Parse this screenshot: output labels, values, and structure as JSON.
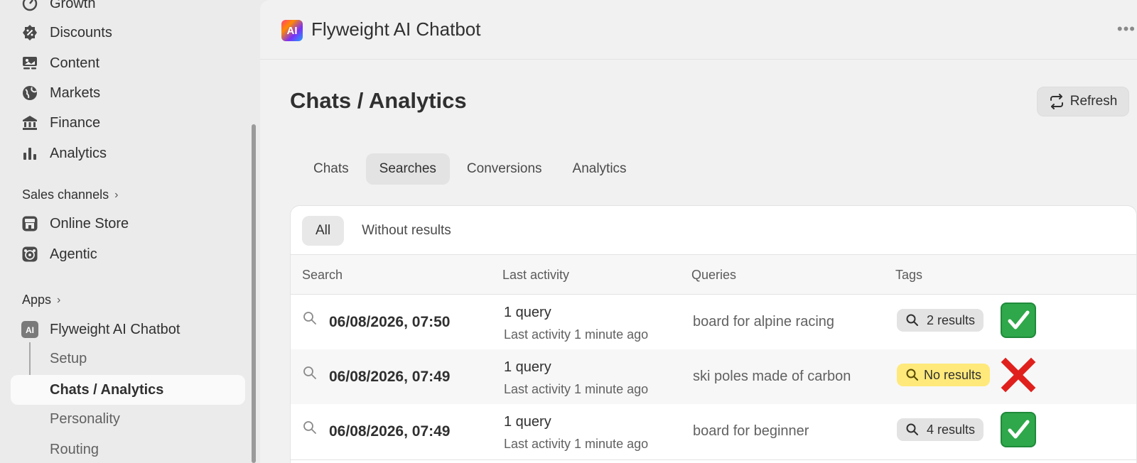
{
  "sidebar": {
    "items": [
      {
        "label": "Growth",
        "icon": "growth-icon"
      },
      {
        "label": "Discounts",
        "icon": "discount-icon"
      },
      {
        "label": "Content",
        "icon": "content-icon"
      },
      {
        "label": "Markets",
        "icon": "globe-icon"
      },
      {
        "label": "Finance",
        "icon": "bank-icon"
      },
      {
        "label": "Analytics",
        "icon": "bar-chart-icon"
      }
    ],
    "sales_channels_label": "Sales channels",
    "channels": [
      {
        "label": "Online Store",
        "icon": "store-icon"
      },
      {
        "label": "Agentic",
        "icon": "agentic-icon"
      }
    ],
    "apps_label": "Apps",
    "app": {
      "label": "Flyweight AI Chatbot",
      "icon": "ai-app-icon"
    },
    "app_pages": [
      {
        "label": "Setup"
      },
      {
        "label": "Chats / Analytics",
        "active": true
      },
      {
        "label": "Personality"
      },
      {
        "label": "Routing"
      }
    ]
  },
  "header": {
    "logo_text": "AI",
    "title": "Flyweight AI Chatbot",
    "more": "•••"
  },
  "page": {
    "title": "Chats / Analytics",
    "refresh_label": "Refresh"
  },
  "tabs": [
    {
      "label": "Chats"
    },
    {
      "label": "Searches",
      "active": true
    },
    {
      "label": "Conversions"
    },
    {
      "label": "Analytics"
    }
  ],
  "filters": [
    {
      "label": "All",
      "active": true
    },
    {
      "label": "Without results"
    }
  ],
  "table": {
    "headers": [
      "Search",
      "Last activity",
      "Queries",
      "Tags"
    ],
    "rows": [
      {
        "date": "06/08/2026, 07:50",
        "count": "1 query",
        "activity": "Last activity 1 minute ago",
        "query": "board for alpine racing",
        "tag": "2 results",
        "tag_type": "results",
        "status": "success"
      },
      {
        "date": "06/08/2026, 07:49",
        "count": "1 query",
        "activity": "Last activity 1 minute ago",
        "query": "ski poles made of carbon",
        "tag": "No results",
        "tag_type": "none",
        "status": "fail"
      },
      {
        "date": "06/08/2026, 07:49",
        "count": "1 query",
        "activity": "Last activity 1 minute ago",
        "query": "board for beginner",
        "tag": "4 results",
        "tag_type": "results",
        "status": "success"
      }
    ]
  },
  "colors": {
    "warning_tag": "#ffe97a",
    "success": "#2ea84a",
    "fail": "#e0201c"
  }
}
